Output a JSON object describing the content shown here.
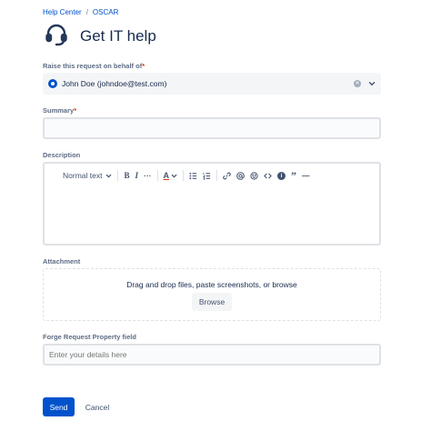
{
  "breadcrumb": {
    "home": "Help Center",
    "separator": "/",
    "project": "OSCAR"
  },
  "header": {
    "title": "Get IT help",
    "icon": "headset-icon"
  },
  "form": {
    "behalf": {
      "label": "Raise this request on behalf of",
      "required": "*",
      "value": "John Doe (johndoe@test.com)"
    },
    "summary": {
      "label": "Summary",
      "required": "*",
      "value": ""
    },
    "description": {
      "label": "Description",
      "toolbar": {
        "text_style": "Normal text",
        "bold": "B",
        "italic": "I",
        "more": "···",
        "text_color": "A",
        "info": "i",
        "quote": "”",
        "divider": "—"
      }
    },
    "attachment": {
      "label": "Attachment",
      "drop_text": "Drag and drop files, paste screenshots, or browse",
      "browse_label": "Browse"
    },
    "forge": {
      "label": "Forge Request Property field",
      "placeholder": "Enter your details here"
    }
  },
  "actions": {
    "send": "Send",
    "cancel": "Cancel"
  },
  "colors": {
    "primary": "#0052cc",
    "text": "#172b4d",
    "subtle": "#5e6c84",
    "required": "#de350b",
    "border": "#dfe1e6"
  }
}
